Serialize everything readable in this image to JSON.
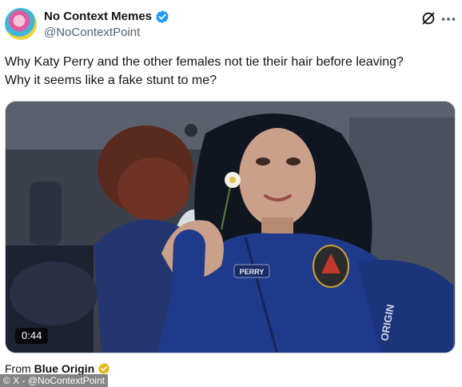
{
  "tweet": {
    "author_name": "No Context Memes",
    "handle": "@NoContextPoint",
    "text_line1": "Why Katy Perry and the other females not tie their hair before leaving?",
    "text_line2": "Why it seems like a fake stunt to me?"
  },
  "media": {
    "type": "video",
    "duration": "0:44",
    "suit_name_patch": "PERRY",
    "sleeve_text": "ORIGIN"
  },
  "source": {
    "prefix": "From",
    "name": "Blue Origin"
  },
  "credit": "© X - @NoContextPoint",
  "colors": {
    "verified": "#1d9bf0",
    "gold_verified": "#e2b719",
    "flight_suit": "#1f3a8a"
  }
}
